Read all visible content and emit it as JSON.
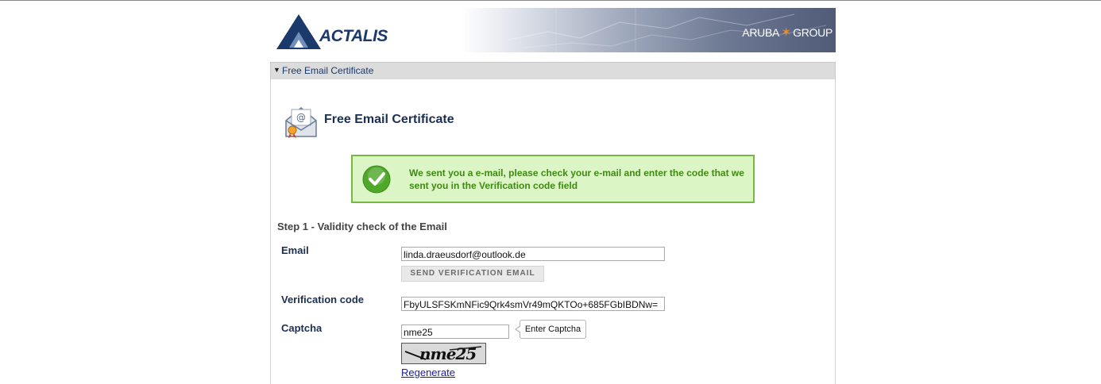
{
  "header": {
    "logo_text": "ACTALIS",
    "group_left": "ARUBA",
    "group_right": "GROUP"
  },
  "panel": {
    "bar_label": "Free Email Certificate"
  },
  "page_title": "Free Email Certificate",
  "message": "We sent you a e-mail, please check your e-mail and enter the code that we sent you in the Verification code field",
  "step_title": "Step 1 - Validity check of the Email",
  "form": {
    "email_label": "Email",
    "email_value": "linda.draeusdorf@outlook.de",
    "send_button": "SEND VERIFICATION EMAIL",
    "verification_label": "Verification code",
    "verification_value": "FbyULSFSKmNFic9Qrk4smVr49mQKTOo+685FGbIBDNw=",
    "captcha_label": "Captcha",
    "captcha_value": "nme25",
    "captcha_tooltip": "Enter Captcha",
    "captcha_image_text": "nme25",
    "regenerate": "Regenerate"
  }
}
